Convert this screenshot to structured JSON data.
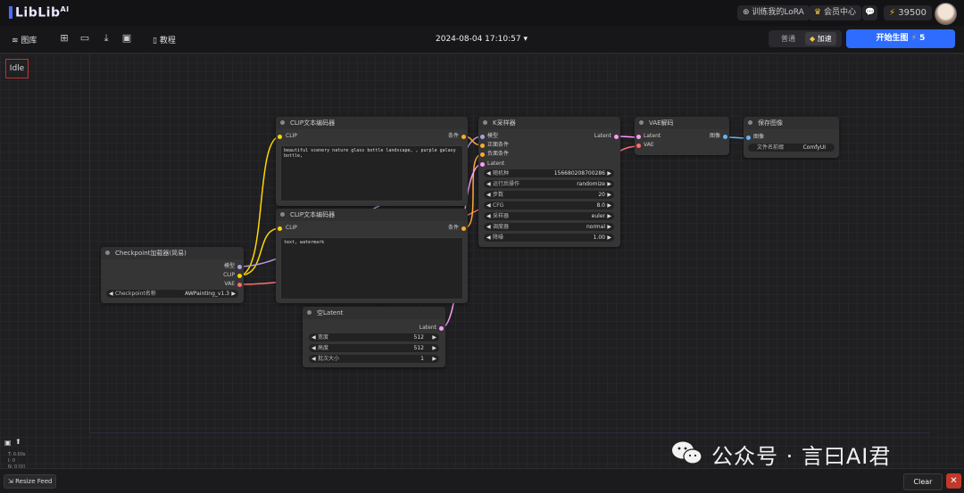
{
  "header": {
    "logo_text": "LibLib",
    "logo_sup": "AI",
    "train_lora": "训练我的LoRA",
    "member_center": "会员中心",
    "points": "39500"
  },
  "toolbar": {
    "library": "图库",
    "tutorial": "教程",
    "datetime": "2024-08-04 17:10:57",
    "mode_normal": "普通",
    "mode_fast": "加速",
    "run_label": "开始生图",
    "run_cost": "5"
  },
  "status": {
    "idle": "Idle"
  },
  "nodes": {
    "clip1": {
      "title": "CLIP文本编码器",
      "in_clip": "CLIP",
      "out_cond": "条件",
      "text": "beautiful scenery nature glass bottle landscape, , purple galaxy bottle,"
    },
    "clip2": {
      "title": "CLIP文本编码器",
      "in_clip": "CLIP",
      "out_cond": "条件",
      "text": "text, watermark"
    },
    "checkpoint": {
      "title": "Checkpoint加载器(简易)",
      "out_model": "模型",
      "out_clip": "CLIP",
      "out_vae": "VAE",
      "w_label": "Checkpoint名称",
      "w_value": "AWPainting_v1.3"
    },
    "ksampler": {
      "title": "K采样器",
      "in_model": "模型",
      "in_pos": "正面条件",
      "in_neg": "负面条件",
      "in_latent": "Latent",
      "out_latent": "Latent",
      "widgets": [
        {
          "label": "随机种",
          "value": "156680208700286"
        },
        {
          "label": "运行后操作",
          "value": "randomize"
        },
        {
          "label": "步数",
          "value": "20"
        },
        {
          "label": "CFG",
          "value": "8.0"
        },
        {
          "label": "采样器",
          "value": "euler"
        },
        {
          "label": "调度器",
          "value": "normal"
        },
        {
          "label": "降噪",
          "value": "1.00"
        }
      ]
    },
    "vae": {
      "title": "VAE解码",
      "in_latent": "Latent",
      "in_vae": "VAE",
      "out_image": "图像"
    },
    "save": {
      "title": "保存图像",
      "in_image": "图像",
      "w_label": "文件名前缀",
      "w_value": "ComfyUI"
    },
    "empty_latent": {
      "title": "空Latent",
      "out_latent": "Latent",
      "widgets": [
        {
          "label": "宽度",
          "value": "512"
        },
        {
          "label": "高度",
          "value": "512"
        },
        {
          "label": "批次大小",
          "value": "1"
        }
      ]
    }
  },
  "stats": {
    "t": "T: 0.00s",
    "i": "I: 0",
    "n": "N: 0 [0]"
  },
  "bottom": {
    "resize_feed": "Resize Feed",
    "clear": "Clear",
    "close": "✕"
  },
  "watermark": "公众号 · 言曰AI君",
  "colors": {
    "accent": "#2d6cff",
    "clip_wire": "#ffd500",
    "model_wire": "#b39ddb",
    "vae_wire": "#ff6e6e",
    "latent_wire": "#ff9cf9",
    "cond_wire": "#ffa931",
    "image_wire": "#64b5f6"
  }
}
